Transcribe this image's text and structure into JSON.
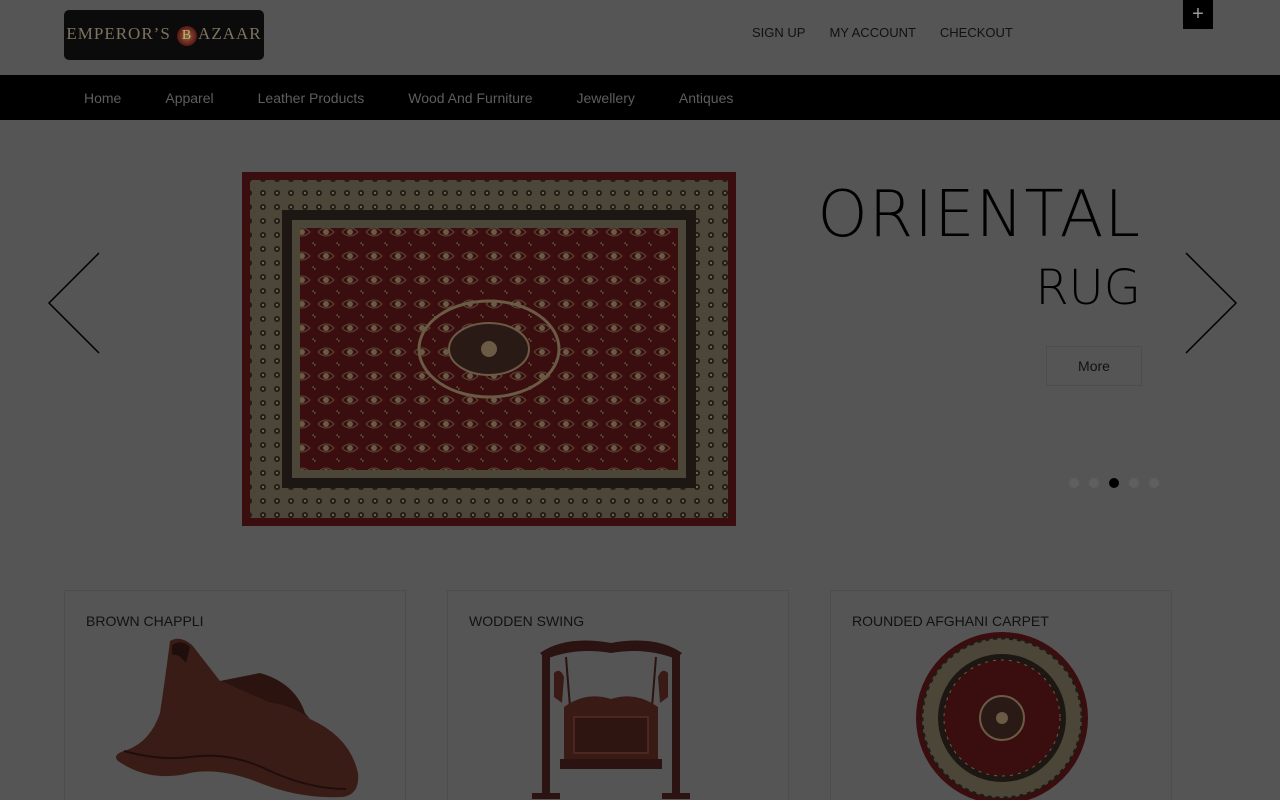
{
  "header": {
    "logo_alt": "EMPEROR'S BAZAAR",
    "logo_part1": "EMPEROR’S",
    "logo_medallion_letter": "B",
    "logo_part2": "AZAAR",
    "links": [
      "SIGN UP",
      "MY ACCOUNT",
      "CHECKOUT"
    ],
    "plus_icon": "+"
  },
  "nav": {
    "items": [
      "Home",
      "Apparel",
      "Leather Products",
      "Wood And Furniture",
      "Jewellery",
      "Antiques"
    ]
  },
  "slider": {
    "title": "ORIENTAL",
    "subtitle": "RUG",
    "more_label": "More",
    "dots_count": 5,
    "active_index": 2,
    "prev_icon": "chevron-left-icon",
    "next_icon": "chevron-right-icon"
  },
  "products": [
    {
      "title": "BROWN CHAPPLI",
      "icon": "sandal-image"
    },
    {
      "title": "WODDEN SWING",
      "icon": "swing-image"
    },
    {
      "title": "ROUNDED AFGHANI CARPET",
      "icon": "round-carpet-image"
    }
  ],
  "colors": {
    "overlay_bg": "#555555",
    "nav_bg": "#000000",
    "rug_red": "#3a0d0f",
    "text": "#111111"
  }
}
